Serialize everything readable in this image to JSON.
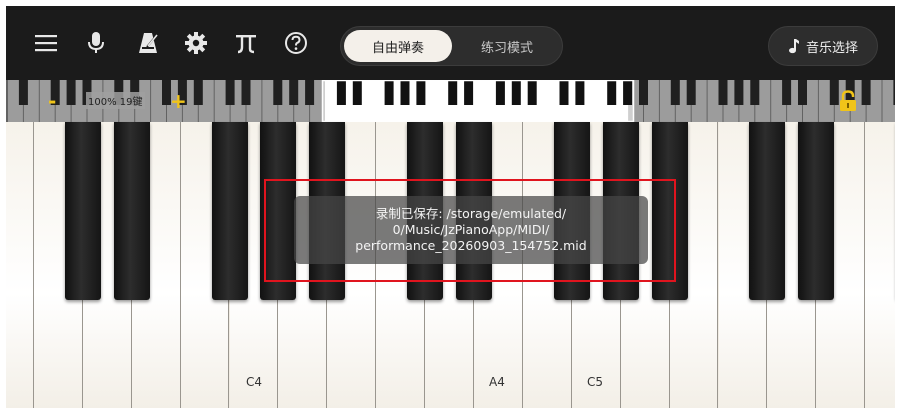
{
  "toolbar": {
    "icons": [
      "menu-icon",
      "microphone-icon",
      "metronome-icon",
      "settings-gear-icon",
      "pi-icon",
      "help-icon"
    ],
    "mode_free": "自由弹奏",
    "mode_practice": "练习模式",
    "music_select": "音乐选择"
  },
  "mini_keyboard": {
    "minus": "-",
    "plus": "+",
    "zoom_label": "100% 19键"
  },
  "keyboard": {
    "labels": {
      "c4": "C4",
      "a4": "A4",
      "c5": "C5"
    }
  },
  "toast": {
    "message": "录制已保存: /storage/emulated/\n0/Music/JzPianoApp/MIDI/\nperformance_20260903_154752.mid"
  },
  "colors": {
    "toolbar_bg": "#1b1b1b",
    "accent_yellow": "#f0c419",
    "highlight_red": "#e0141e"
  }
}
